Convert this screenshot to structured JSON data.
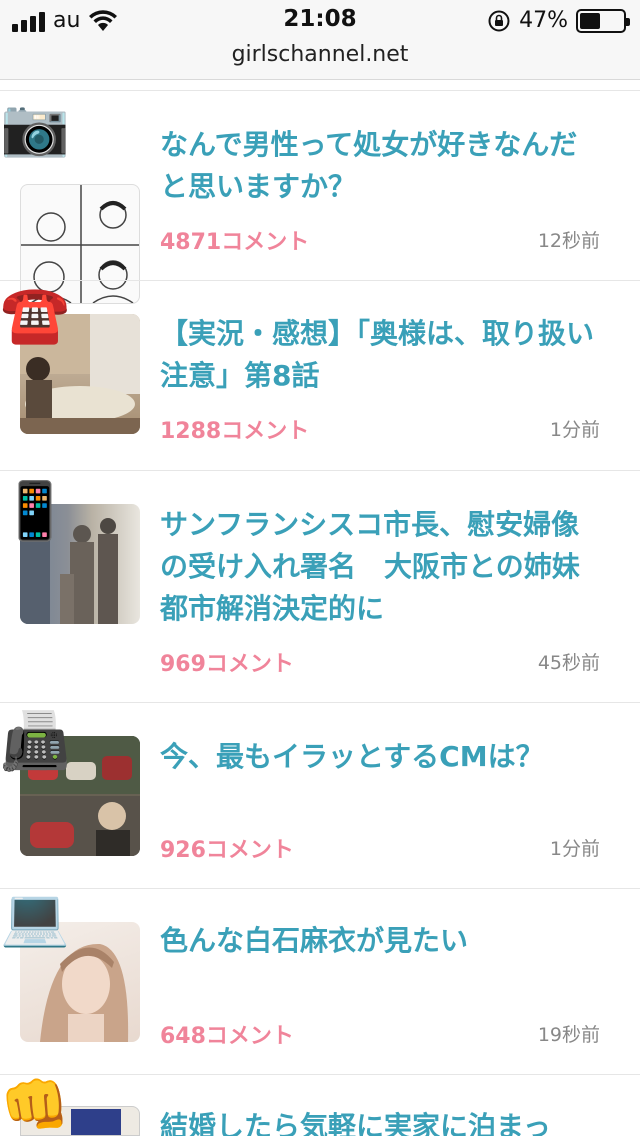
{
  "status_bar": {
    "carrier": "au",
    "time": "21:08",
    "battery_percent": "47%",
    "battery_level": 0.47,
    "url": "girlschannel.net"
  },
  "topics": [
    {
      "emoji": "📷",
      "title": "なんで男性って処女が好きなんだと思いますか？",
      "comments": "4871コメント",
      "time": "12秒前"
    },
    {
      "emoji": "☎️",
      "title": "【実況・感想】「奥様は、取り扱い注意」第8話",
      "comments": "1288コメント",
      "time": "1分前"
    },
    {
      "emoji": "📱",
      "title": "サンフランシスコ市長、慰安婦像の受け入れ署名　大阪市との姉妹都市解消決定的に",
      "comments": "969コメント",
      "time": "45秒前"
    },
    {
      "emoji": "📠",
      "title": "今、最もイラッとするCMは？",
      "comments": "926コメント",
      "time": "1分前"
    },
    {
      "emoji": "💻",
      "title": "色んな白石麻衣が見たい",
      "comments": "648コメント",
      "time": "19秒前"
    },
    {
      "emoji": "👊",
      "title": "結婚したら気軽に実家に泊まっ",
      "comments": "",
      "time": ""
    }
  ]
}
